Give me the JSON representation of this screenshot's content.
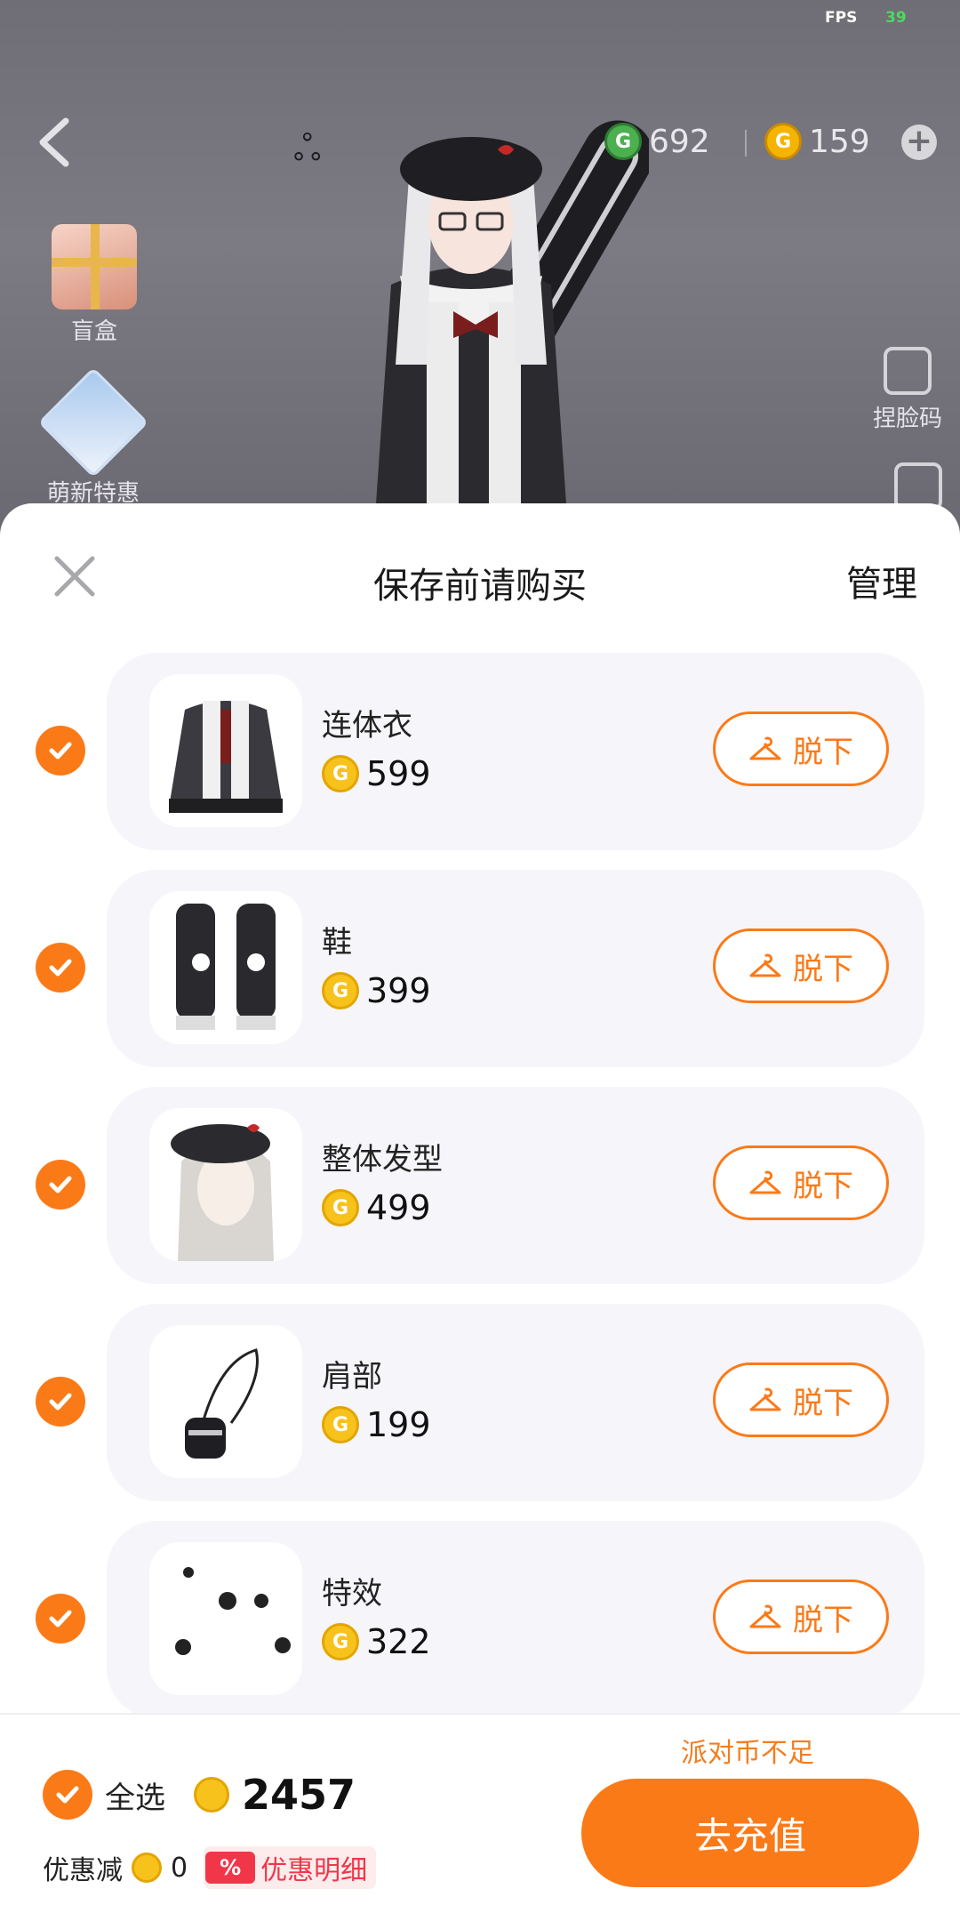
{
  "status": {
    "fps_label": "FPS",
    "fps_value": "39"
  },
  "header": {
    "currencies": [
      {
        "name": "party-coin",
        "amount": "692",
        "color": "#4caf50"
      },
      {
        "name": "gold-coin",
        "amount": "159",
        "color": "#f4b400"
      }
    ]
  },
  "sidebar": {
    "blind_box_label": "盲盒",
    "promo_label": "萌新特惠",
    "face_code_label": "捏脸码"
  },
  "sheet": {
    "title": "保存前请购买",
    "manage_label": "管理",
    "takeoff_label": "脱下",
    "items": [
      {
        "name": "连体衣",
        "price": "599",
        "checked": true
      },
      {
        "name": "鞋",
        "price": "399",
        "checked": true
      },
      {
        "name": "整体发型",
        "price": "499",
        "checked": true
      },
      {
        "name": "肩部",
        "price": "199",
        "checked": true
      },
      {
        "name": "特效",
        "price": "322",
        "checked": true
      }
    ]
  },
  "footer": {
    "insufficient_label": "派对币不足",
    "select_all_label": "全选",
    "total_price": "2457",
    "discount_label": "优惠减",
    "discount_value": "0",
    "discount_icon_text": "%",
    "discount_detail_label": "优惠明细",
    "recharge_label": "去充值"
  },
  "colors": {
    "accent": "#fb7a18",
    "coin": "#f8c21c",
    "discount_red": "#f2364a"
  }
}
